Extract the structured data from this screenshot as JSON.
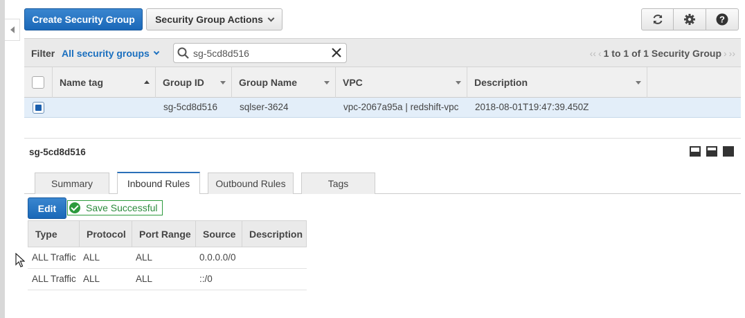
{
  "toolbar": {
    "create_label": "Create Security Group",
    "actions_label": "Security Group Actions",
    "icons": [
      "refresh-icon",
      "gear-icon",
      "help-icon"
    ]
  },
  "filter": {
    "label": "Filter",
    "select_value": "All security groups",
    "search_value": "sg-5cd8d516",
    "pager_text": "1 to 1 of 1 Security Group"
  },
  "table": {
    "columns": [
      "Name tag",
      "Group ID",
      "Group Name",
      "VPC",
      "Description"
    ],
    "rows": [
      {
        "name_tag": "",
        "group_id": "sg-5cd8d516",
        "group_name": "sqlser-3624",
        "vpc": "vpc-2067a95a | redshift-vpc",
        "description": "2018-08-01T19:47:39.450Z"
      }
    ]
  },
  "detail": {
    "title": "sg-5cd8d516",
    "tabs": [
      "Summary",
      "Inbound Rules",
      "Outbound Rules",
      "Tags"
    ],
    "active_tab": "Inbound Rules",
    "edit_label": "Edit",
    "save_message": "Save Successful",
    "rules_columns": [
      "Type",
      "Protocol",
      "Port Range",
      "Source",
      "Description"
    ],
    "rules": [
      {
        "type": "ALL Traffic",
        "protocol": "ALL",
        "port_range": "ALL",
        "source": "0.0.0.0/0",
        "description": ""
      },
      {
        "type": "ALL Traffic",
        "protocol": "ALL",
        "port_range": "ALL",
        "source": "::/0",
        "description": ""
      }
    ]
  },
  "colors": {
    "primary": "#1a68b8",
    "link": "#1a6fbf",
    "success": "#2b9a3c",
    "selected_row": "#e3eef9"
  }
}
